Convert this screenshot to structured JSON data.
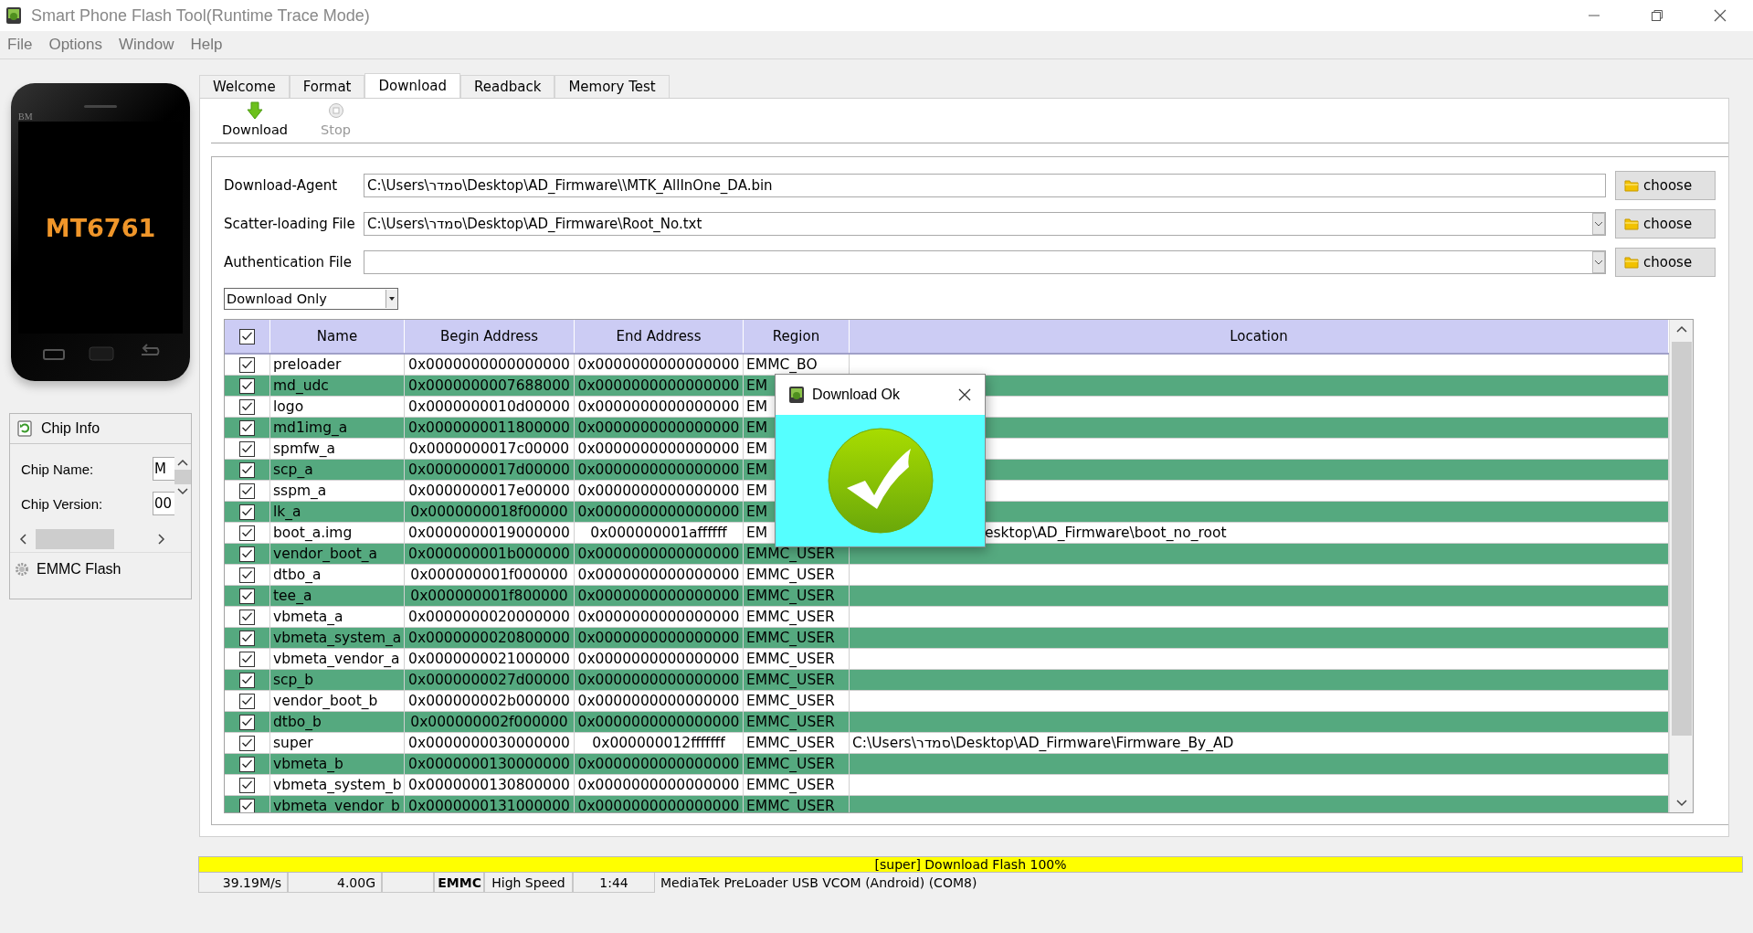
{
  "window": {
    "title": "Smart Phone Flash Tool(Runtime Trace Mode)"
  },
  "menu": [
    "File",
    "Options",
    "Window",
    "Help"
  ],
  "phone": {
    "brand": "BM",
    "chip": "MT6761"
  },
  "chip_info": {
    "title": "Chip Info",
    "fields": [
      {
        "label": "Chip Name:",
        "value": "M"
      },
      {
        "label": "Chip Version:",
        "value": "00"
      }
    ]
  },
  "emmc_flash": {
    "label": "EMMC Flash"
  },
  "tabs": [
    {
      "label": "Welcome",
      "selected": false
    },
    {
      "label": "Format",
      "selected": false
    },
    {
      "label": "Download",
      "selected": true
    },
    {
      "label": "Readback",
      "selected": false
    },
    {
      "label": "Memory Test",
      "selected": false
    }
  ],
  "toolbar": [
    {
      "kind": "download",
      "label": "Download",
      "disabled": false
    },
    {
      "kind": "stop",
      "label": "Stop",
      "disabled": true
    }
  ],
  "files": [
    {
      "kind": "text",
      "label": "Download-Agent",
      "value": "C:\\Users\\סמדר\\Desktop\\AD_Firmware\\\\MTK_AllInOne_DA.bin",
      "button": "choose"
    },
    {
      "kind": "combo",
      "label": "Scatter-loading File",
      "value": "C:\\Users\\סמדר\\Desktop\\AD_Firmware\\Root_No.txt",
      "button": "choose"
    },
    {
      "kind": "combo",
      "label": "Authentication File",
      "button": "choose"
    }
  ],
  "mode": {
    "value": "Download Only"
  },
  "table": {
    "all_checked": true,
    "columns": [
      "Name",
      "Begin Address",
      "End Address",
      "Region",
      "Location"
    ],
    "rows": [
      {
        "checked": true,
        "name": "preloader",
        "begin": "0x0000000000000000",
        "end": "0x0000000000000000",
        "region": "EMMC_BO"
      },
      {
        "checked": true,
        "name": "md_udc",
        "begin": "0x0000000007688000",
        "end": "0x0000000000000000",
        "region": "EM"
      },
      {
        "checked": true,
        "name": "logo",
        "begin": "0x0000000010d00000",
        "end": "0x0000000000000000",
        "region": "EM"
      },
      {
        "checked": true,
        "name": "md1img_a",
        "begin": "0x0000000011800000",
        "end": "0x0000000000000000",
        "region": "EM"
      },
      {
        "checked": true,
        "name": "spmfw_a",
        "begin": "0x0000000017c00000",
        "end": "0x0000000000000000",
        "region": "EM"
      },
      {
        "checked": true,
        "name": "scp_a",
        "begin": "0x0000000017d00000",
        "end": "0x0000000000000000",
        "region": "EM"
      },
      {
        "checked": true,
        "name": "sspm_a",
        "begin": "0x0000000017e00000",
        "end": "0x0000000000000000",
        "region": "EM"
      },
      {
        "checked": true,
        "name": "lk_a",
        "begin": "0x0000000018f00000",
        "end": "0x0000000000000000",
        "region": "EM"
      },
      {
        "checked": true,
        "name": "boot_a.img",
        "begin": "0x0000000019000000",
        "end": "0x000000001affffff",
        "region": "EM",
        "location": "esktop\\AD_Firmware\\boot_no_root"
      },
      {
        "checked": true,
        "name": "vendor_boot_a",
        "begin": "0x000000001b000000",
        "end": "0x0000000000000000",
        "region": "EMMC_USER"
      },
      {
        "checked": true,
        "name": "dtbo_a",
        "begin": "0x000000001f000000",
        "end": "0x0000000000000000",
        "region": "EMMC_USER"
      },
      {
        "checked": true,
        "name": "tee_a",
        "begin": "0x000000001f800000",
        "end": "0x0000000000000000",
        "region": "EMMC_USER"
      },
      {
        "checked": true,
        "name": "vbmeta_a",
        "begin": "0x0000000020000000",
        "end": "0x0000000000000000",
        "region": "EMMC_USER"
      },
      {
        "checked": true,
        "name": "vbmeta_system_a",
        "begin": "0x0000000020800000",
        "end": "0x0000000000000000",
        "region": "EMMC_USER"
      },
      {
        "checked": true,
        "name": "vbmeta_vendor_a",
        "begin": "0x0000000021000000",
        "end": "0x0000000000000000",
        "region": "EMMC_USER"
      },
      {
        "checked": true,
        "name": "scp_b",
        "begin": "0x0000000027d00000",
        "end": "0x0000000000000000",
        "region": "EMMC_USER"
      },
      {
        "checked": true,
        "name": "vendor_boot_b",
        "begin": "0x000000002b000000",
        "end": "0x0000000000000000",
        "region": "EMMC_USER"
      },
      {
        "checked": true,
        "name": "dtbo_b",
        "begin": "0x000000002f000000",
        "end": "0x0000000000000000",
        "region": "EMMC_USER"
      },
      {
        "checked": true,
        "name": "super",
        "begin": "0x0000000030000000",
        "end": "0x000000012fffffff",
        "region": "EMMC_USER",
        "location": "C:\\Users\\סמדר\\Desktop\\AD_Firmware\\Firmware_By_AD"
      },
      {
        "checked": true,
        "name": "vbmeta_b",
        "begin": "0x0000000130000000",
        "end": "0x0000000000000000",
        "region": "EMMC_USER"
      },
      {
        "checked": true,
        "name": "vbmeta_system_b",
        "begin": "0x0000000130800000",
        "end": "0x0000000000000000",
        "region": "EMMC_USER"
      },
      {
        "checked": true,
        "name": "vbmeta_vendor_b",
        "begin": "0x0000000131000000",
        "end": "0x0000000000000000",
        "region": "EMMC_USER"
      }
    ]
  },
  "dialog": {
    "title": "Download Ok"
  },
  "progress": {
    "text": "[super] Download Flash 100%",
    "level": 1
  },
  "status_bar": {
    "speed": "39.19M/s",
    "size": "4.00G",
    "storage": "EMMC",
    "speed_mode": "High Speed",
    "time": "1:44",
    "port": "MediaTek PreLoader USB VCOM (Android) (COM8)"
  }
}
